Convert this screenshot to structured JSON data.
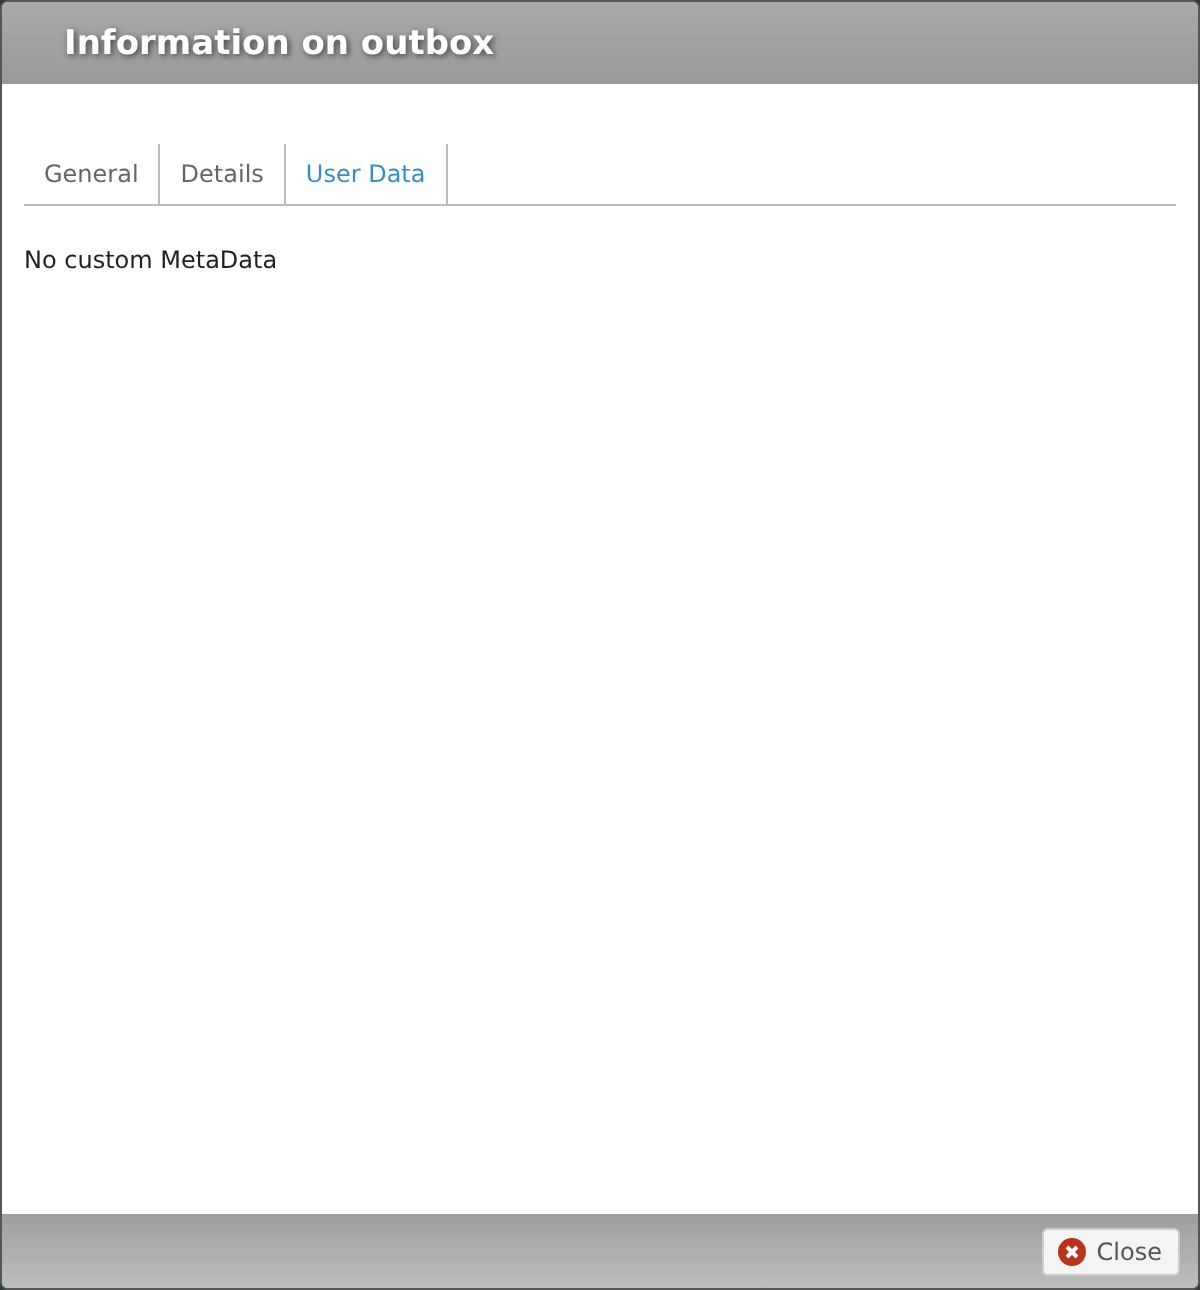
{
  "window": {
    "title": "Information on outbox"
  },
  "tabs": [
    {
      "label": "General",
      "selected": false
    },
    {
      "label": "Details",
      "selected": false
    },
    {
      "label": "User Data",
      "selected": true
    }
  ],
  "content": {
    "message": "No custom MetaData"
  },
  "buttons": [
    {
      "label": "Close"
    }
  ]
}
